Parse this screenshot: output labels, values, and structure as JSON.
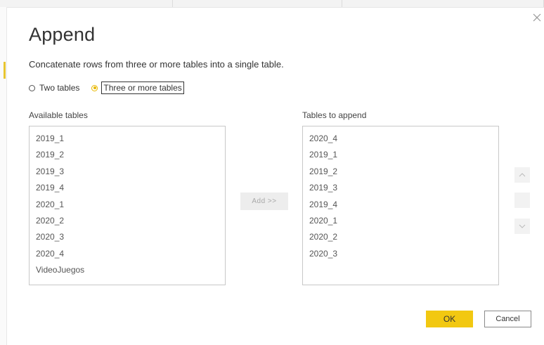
{
  "dialog": {
    "title": "Append",
    "description": "Concatenate rows from three or more tables into a single table.",
    "options": [
      {
        "label": "Two tables",
        "selected": false
      },
      {
        "label": "Three or more tables",
        "selected": true
      }
    ]
  },
  "available": {
    "label": "Available tables",
    "items": [
      "2019_1",
      "2019_2",
      "2019_3",
      "2019_4",
      "2020_1",
      "2020_2",
      "2020_3",
      "2020_4",
      "VideoJuegos"
    ]
  },
  "add_button": "Add >>",
  "append": {
    "label": "Tables to append",
    "items": [
      "2020_4",
      "2019_1",
      "2019_2",
      "2019_3",
      "2019_4",
      "2020_1",
      "2020_2",
      "2020_3"
    ]
  },
  "footer": {
    "ok": "OK",
    "cancel": "Cancel"
  },
  "colors": {
    "accent": "#f2c811",
    "selected_radio": "#e8b800"
  },
  "icons": [
    "close-icon",
    "move-up-icon",
    "remove-icon",
    "move-down-icon"
  ]
}
